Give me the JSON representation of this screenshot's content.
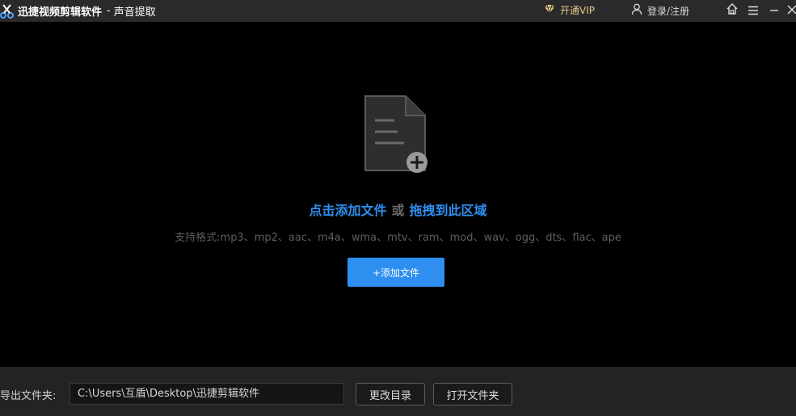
{
  "titlebar": {
    "app_name": "迅捷视频剪辑软件",
    "separator": "-",
    "page_name": "声音提取",
    "vip_label": "开通VIP",
    "login_label": "登录/注册"
  },
  "icons": {
    "app": "scissors-logo-icon",
    "vip": "diamond-icon",
    "login": "user-icon",
    "home": "home-icon",
    "menu": "menu-icon",
    "minimize": "minimize-icon",
    "close": "close-icon",
    "drop": "document-add-icon"
  },
  "drop_area": {
    "click_text": "点击添加文件",
    "or_text": "或",
    "drag_text": "拖拽到此区域",
    "formats": "支持格式:mp3、mp2、aac、m4a、wma、mtv、ram、mod、wav、ogg、dts、flac、ape",
    "add_button": "+添加文件"
  },
  "footer": {
    "output_label": "导出文件夹:",
    "output_path": "C:\\Users\\互盾\\Desktop\\迅捷剪辑软件",
    "change_dir_button": "更改目录",
    "open_folder_button": "打开文件夹"
  },
  "colors": {
    "accent": "#2e8ff0",
    "vip": "#e8c98a",
    "background": "#000000",
    "titlebar": "#2a2a2a"
  }
}
